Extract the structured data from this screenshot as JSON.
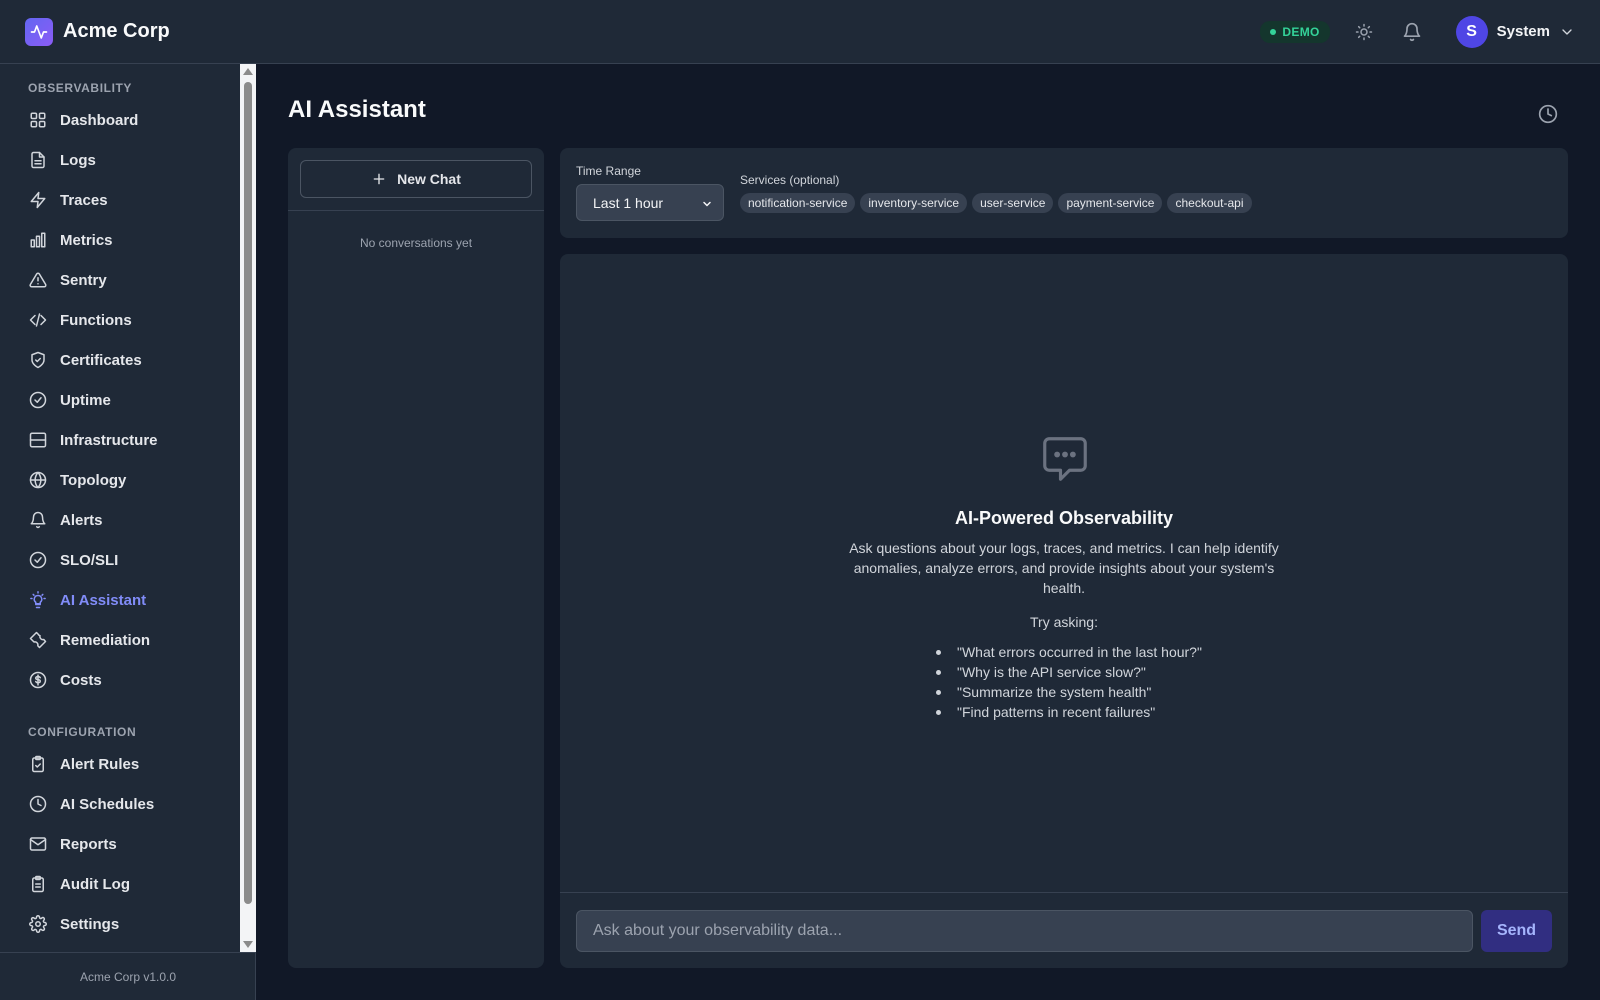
{
  "header": {
    "brand": "Acme Corp",
    "demo_badge": "DEMO",
    "user_initial": "S",
    "user_name": "System"
  },
  "sidebar": {
    "sections": [
      {
        "label": "OBSERVABILITY",
        "items": [
          {
            "label": "Dashboard",
            "icon": "grid-icon"
          },
          {
            "label": "Logs",
            "icon": "file-icon"
          },
          {
            "label": "Traces",
            "icon": "bolt-icon"
          },
          {
            "label": "Metrics",
            "icon": "bar-chart-icon"
          },
          {
            "label": "Sentry",
            "icon": "warning-icon"
          },
          {
            "label": "Functions",
            "icon": "code-icon"
          },
          {
            "label": "Certificates",
            "icon": "shield-icon"
          },
          {
            "label": "Uptime",
            "icon": "check-circle-icon"
          },
          {
            "label": "Infrastructure",
            "icon": "server-icon"
          },
          {
            "label": "Topology",
            "icon": "globe-icon"
          },
          {
            "label": "Alerts",
            "icon": "bell-icon"
          },
          {
            "label": "SLO/SLI",
            "icon": "check-circle-icon"
          },
          {
            "label": "AI Assistant",
            "icon": "lightbulb-icon",
            "active": true
          },
          {
            "label": "Remediation",
            "icon": "wrench-icon"
          },
          {
            "label": "Costs",
            "icon": "dollar-icon"
          }
        ]
      },
      {
        "label": "CONFIGURATION",
        "items": [
          {
            "label": "Alert Rules",
            "icon": "clipboard-check-icon"
          },
          {
            "label": "AI Schedules",
            "icon": "clock-icon"
          },
          {
            "label": "Reports",
            "icon": "mail-icon"
          },
          {
            "label": "Audit Log",
            "icon": "clipboard-icon"
          },
          {
            "label": "Settings",
            "icon": "gear-icon"
          }
        ]
      }
    ],
    "footer": "Acme Corp v1.0.0"
  },
  "page": {
    "title": "AI Assistant"
  },
  "conversations": {
    "new_chat_label": "New Chat",
    "empty_text": "No conversations yet"
  },
  "filters": {
    "time_range_label": "Time Range",
    "time_range_value": "Last 1 hour",
    "services_label": "Services (optional)",
    "services": [
      "notification-service",
      "inventory-service",
      "user-service",
      "payment-service",
      "checkout-api"
    ]
  },
  "chat": {
    "empty_title": "AI-Powered Observability",
    "empty_description": "Ask questions about your logs, traces, and metrics. I can help identify anomalies, analyze errors, and provide insights about your system's health.",
    "try_label": "Try asking:",
    "suggestions": [
      "\"What errors occurred in the last hour?\"",
      "\"Why is the API service slow?\"",
      "\"Summarize the system health\"",
      "\"Find patterns in recent failures\""
    ],
    "input_placeholder": "Ask about your observability data...",
    "send_label": "Send"
  },
  "colors": {
    "accent": "#818cf8",
    "background": "#111827",
    "panel": "#1f2937",
    "demo_green": "#34d399"
  }
}
